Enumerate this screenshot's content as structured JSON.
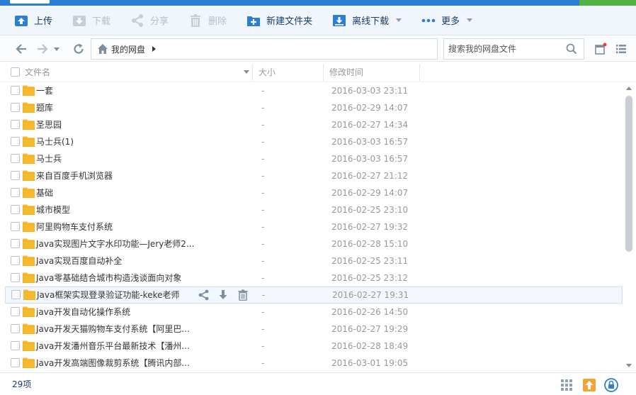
{
  "toolbar": {
    "upload": "上传",
    "download": "下载",
    "share": "分享",
    "delete": "删除",
    "new_folder": "新建文件夹",
    "offline_download": "离线下载",
    "more": "更多"
  },
  "nav": {
    "breadcrumb": "我的网盘",
    "search_placeholder": "搜索我的网盘文件"
  },
  "columns": {
    "name": "文件名",
    "size": "大小",
    "modified": "修改时间"
  },
  "files": [
    {
      "name": "一套",
      "size": "-",
      "date": "2016-03-03 23:11"
    },
    {
      "name": "题库",
      "size": "-",
      "date": "2016-02-29 14:07"
    },
    {
      "name": "圣思园",
      "size": "-",
      "date": "2016-02-27 14:34"
    },
    {
      "name": "马士兵(1)",
      "size": "-",
      "date": "2016-03-03 16:57"
    },
    {
      "name": "马士兵",
      "size": "-",
      "date": "2016-03-03 16:57"
    },
    {
      "name": "来自百度手机浏览器",
      "size": "-",
      "date": "2016-02-27 21:12"
    },
    {
      "name": "基础",
      "size": "-",
      "date": "2016-02-29 14:07"
    },
    {
      "name": "城市模型",
      "size": "-",
      "date": "2016-02-25 23:10"
    },
    {
      "name": "阿里购物车支付系统",
      "size": "-",
      "date": "2016-02-27 19:32"
    },
    {
      "name": "Java实现图片文字水印功能—Jery老师2...",
      "size": "-",
      "date": "2016-02-28 15:10"
    },
    {
      "name": "Java实现百度自动补全",
      "size": "-",
      "date": "2016-02-25 23:11"
    },
    {
      "name": "Java零基础结合城市构造浅谈面向对象",
      "size": "-",
      "date": "2016-02-25 23:12"
    },
    {
      "name": "Java框架实现登录验证功能-keke老师",
      "size": "-",
      "date": "2016-02-27 19:31"
    },
    {
      "name": "java开发自动化操作系统",
      "size": "-",
      "date": "2016-02-26 14:50"
    },
    {
      "name": "Java开发天猫购物车支付系统【阿里巴...",
      "size": "-",
      "date": "2016-02-27 19:29"
    },
    {
      "name": "Java开发潘州音乐平台最新技术【潘州...",
      "size": "-",
      "date": "2016-02-28 18:49"
    },
    {
      "name": "Java开发高端图像裁剪系统【腾讯内部...",
      "size": "-",
      "date": "2016-03-01 19:05"
    }
  ],
  "footer": {
    "count": "29项"
  },
  "colors": {
    "folder": "#f5bb2d",
    "accent": "#2a7ed3",
    "toolbar_text": "#1b3c68"
  }
}
